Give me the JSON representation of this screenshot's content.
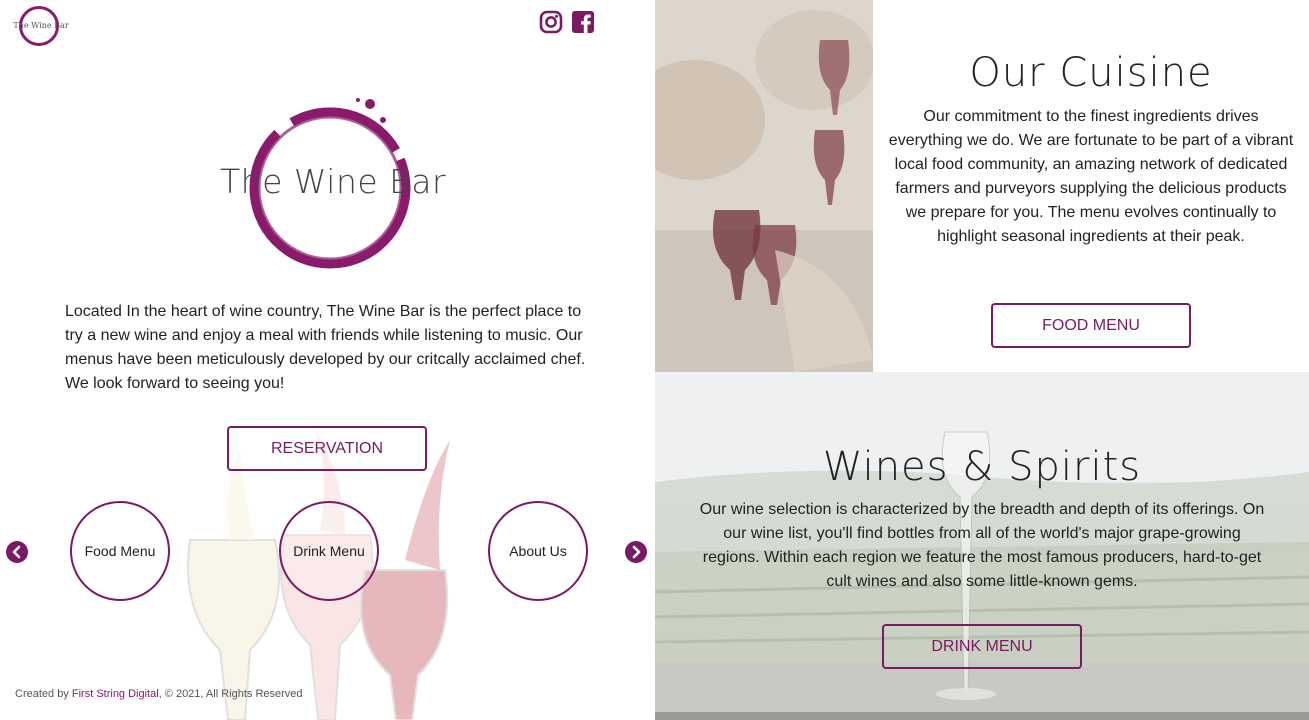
{
  "header": {
    "logo_text": "The Wine Bar",
    "social": [
      {
        "name": "instagram-icon",
        "label": "Instagram"
      },
      {
        "name": "facebook-icon",
        "label": "Facebook"
      }
    ]
  },
  "hero": {
    "logo_text": "The Wine Bar",
    "intro": "Located In the heart of wine country, The Wine Bar is the perfect place to try a new wine and enjoy a meal with friends while listening to music. Our menus have been meticulously developed by our critcally acclaimed chef. We look forward to seeing you!",
    "reservation_label": "RESERVATION"
  },
  "carousel": {
    "items": [
      {
        "label": "Food Menu"
      },
      {
        "label": "Drink Menu"
      },
      {
        "label": "About Us"
      }
    ],
    "prev_icon": "chevron-left-icon",
    "next_icon": "chevron-right-icon"
  },
  "footer": {
    "prefix": "Created by ",
    "link": "First String Digital",
    "suffix": ", © 2021, All Rights Reserved"
  },
  "cuisine": {
    "title": "Our Cuisine",
    "body": "Our commitment to the finest ingredients drives everything we do. We are fortunate to be part of a vibrant local food community, an amazing network of dedicated farmers and purveyors supplying the delicious products we prepare for you. The menu evolves continually to highlight seasonal ingredients at their peak.",
    "button_label": "FOOD MENU"
  },
  "wines": {
    "title": "Wines & Spirits",
    "body": "Our wine selection is characterized by the breadth and depth of its offerings. On our wine list, you'll find bottles from all of the world's major grape-growing regions. Within each region we feature the most famous producers, hard-to-get cult wines and also some little-known gems.",
    "button_label": "DRINK MENU"
  },
  "colors": {
    "accent": "#7a1a62",
    "brand_ring": "#8a1a6b"
  }
}
